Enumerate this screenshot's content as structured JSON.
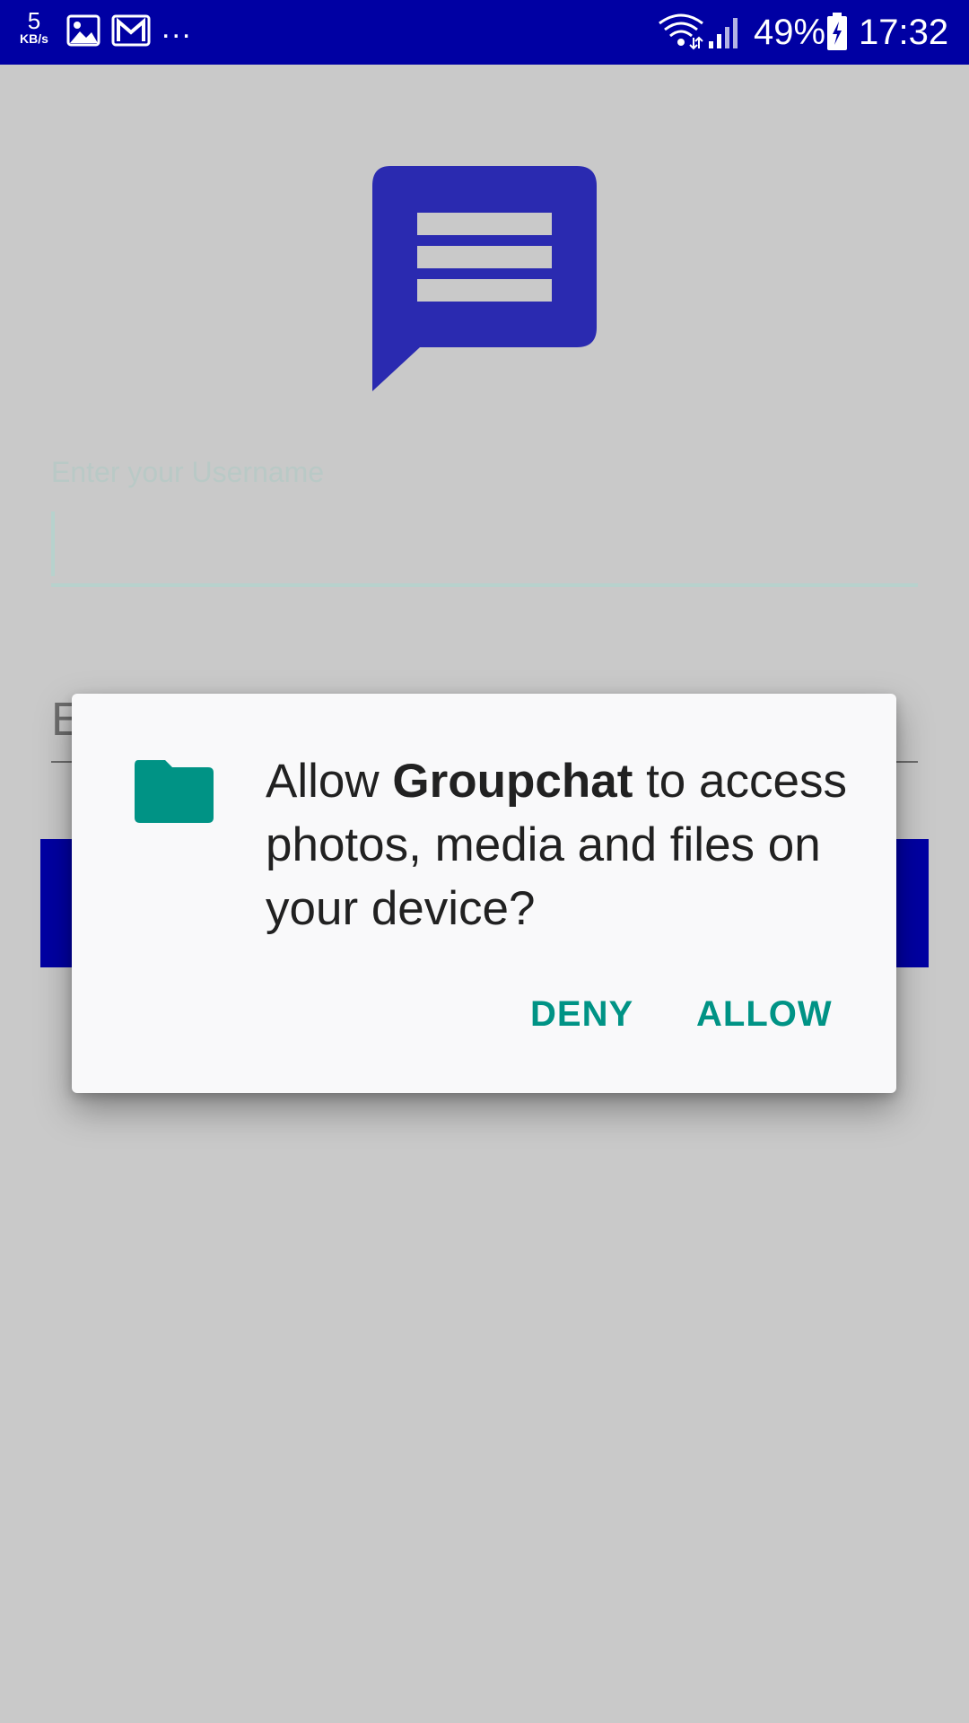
{
  "status_bar": {
    "net_speed_value": "5",
    "net_speed_unit": "KB/s",
    "overflow": "...",
    "battery_percent": "49%",
    "time": "17:32"
  },
  "background_app": {
    "username_hint": "Enter your Username",
    "second_field_partial_text": "E"
  },
  "dialog": {
    "message_prefix": "Allow ",
    "app_name": "Groupchat",
    "message_suffix": " to access photos, media and files on your device?",
    "deny_label": "DENY",
    "allow_label": "ALLOW"
  },
  "colors": {
    "status_bar": "#0000a3",
    "logo": "#2a2ab0",
    "accent_teal": "#009385",
    "scrim_background": "#c9c9c9",
    "dialog_background": "#f9f9fa"
  },
  "icons": {
    "dialog_icon": "folder-icon",
    "app_logo": "chat-bubble-icon",
    "status": [
      "gallery-icon",
      "gmail-icon",
      "wifi-icon",
      "signal-icon",
      "battery-charging-icon"
    ]
  }
}
